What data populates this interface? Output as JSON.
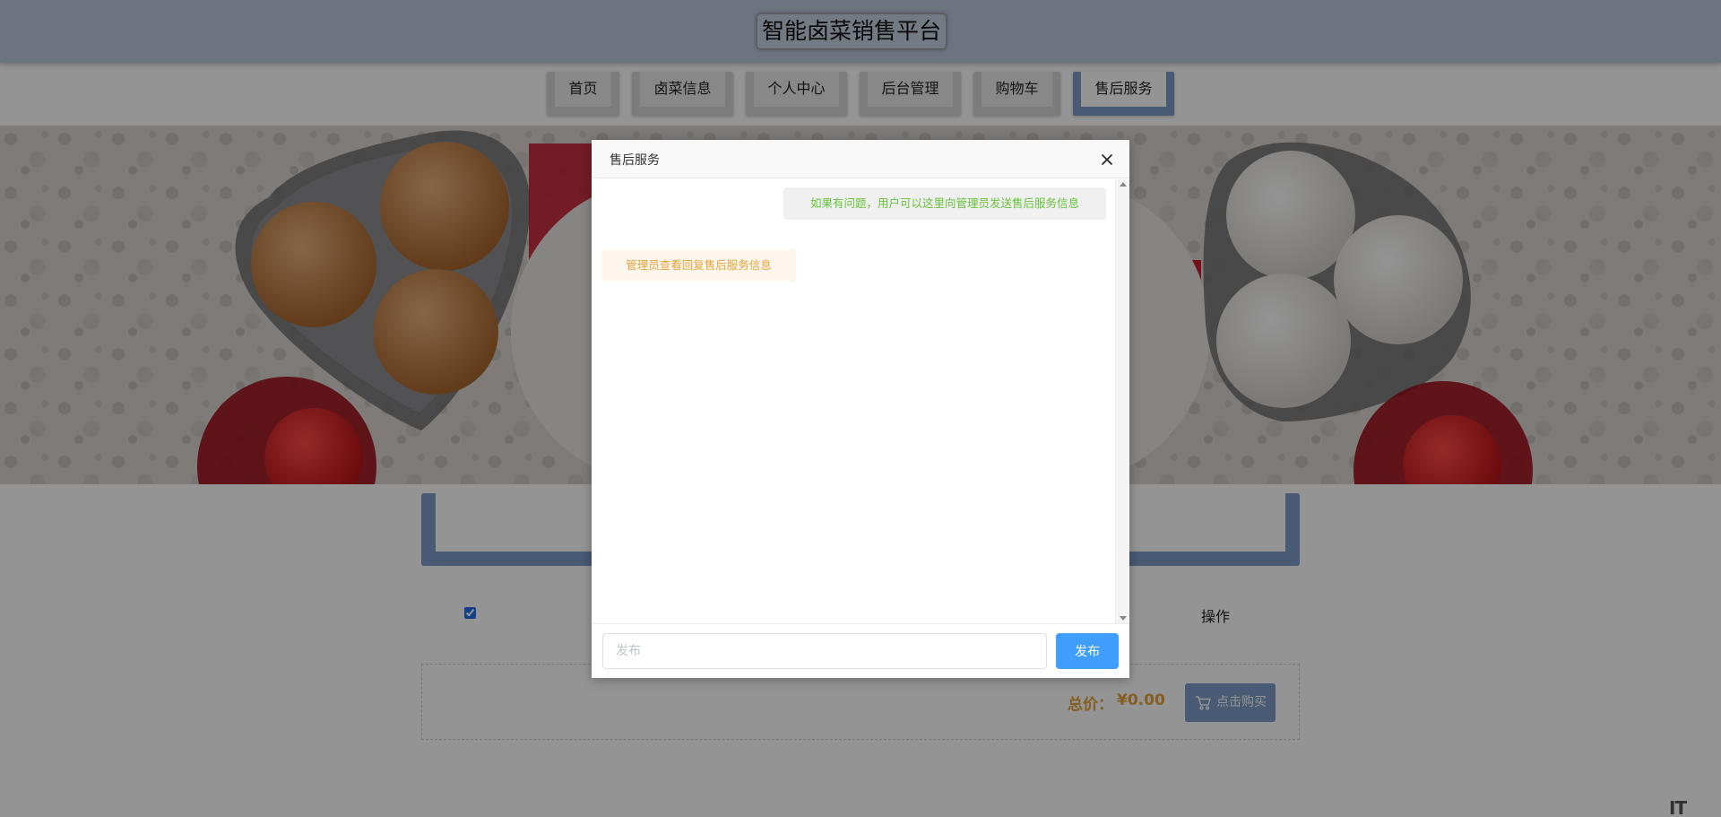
{
  "header": {
    "site_title": "智能卤菜销售平台"
  },
  "nav": {
    "items": [
      {
        "label": "首页"
      },
      {
        "label": "卤菜信息"
      },
      {
        "label": "个人中心"
      },
      {
        "label": "后台管理"
      },
      {
        "label": "购物车"
      },
      {
        "label": "售后服务",
        "active": true
      }
    ]
  },
  "cart": {
    "select_all_checked": true,
    "actions_header": "操作",
    "total_label": "总价：",
    "total_value": "¥0.00",
    "buy_button_label": "点击购买",
    "buy_icon": "cart-icon"
  },
  "modal": {
    "title": "售后服务",
    "close_icon": "close-icon",
    "messages": [
      {
        "role": "user",
        "text": "如果有问题，用户可以这里向管理员发送售后服务信息"
      },
      {
        "role": "admin",
        "text": "管理员查看回复售后服务信息"
      }
    ],
    "input_placeholder": "发布",
    "submit_label": "发布"
  },
  "watermark": "IT",
  "colors": {
    "accent": "#7d9cc8",
    "primary_button": "#409eff",
    "user_message": "#67c23a",
    "admin_message": "#e6a23c",
    "price": "#e6a23c"
  }
}
